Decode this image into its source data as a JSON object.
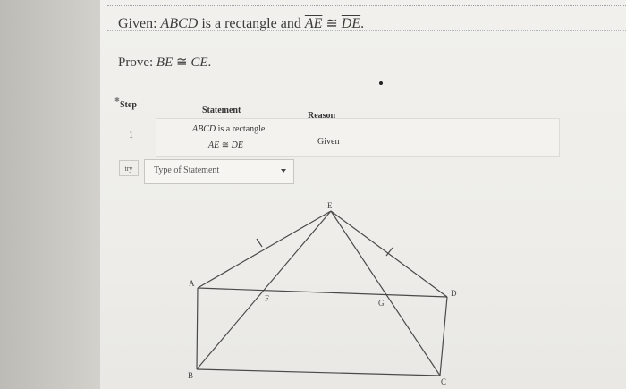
{
  "problem": {
    "given_prefix": "Given: ",
    "given_shape": "ABCD",
    "given_mid": " is a rectangle and ",
    "given_seg1": "AE",
    "given_cong": " ≅ ",
    "given_seg2": "DE",
    "given_end": ".",
    "prove_prefix": "Prove: ",
    "prove_seg1": "BE",
    "prove_cong": " ≅ ",
    "prove_seg2": "CE",
    "prove_end": "."
  },
  "table": {
    "headers": {
      "step": "Step",
      "statement": "Statement",
      "reason": "Reason"
    },
    "rows": [
      {
        "step": "1",
        "statement_line1_shape": "ABCD",
        "statement_line1_text": " is a rectangle",
        "statement_line2_seg1": "AE",
        "statement_line2_cong": " ≅ ",
        "statement_line2_seg2": "DE",
        "reason": "Given"
      }
    ]
  },
  "controls": {
    "try_label": "try",
    "statement_select_placeholder": "Type of Statement"
  },
  "figure": {
    "labels": {
      "A": "A",
      "B": "B",
      "C": "C",
      "D": "D",
      "E": "E",
      "F": "F",
      "G": "G"
    }
  },
  "icons": {
    "dropdown": "chevron-down-icon"
  }
}
